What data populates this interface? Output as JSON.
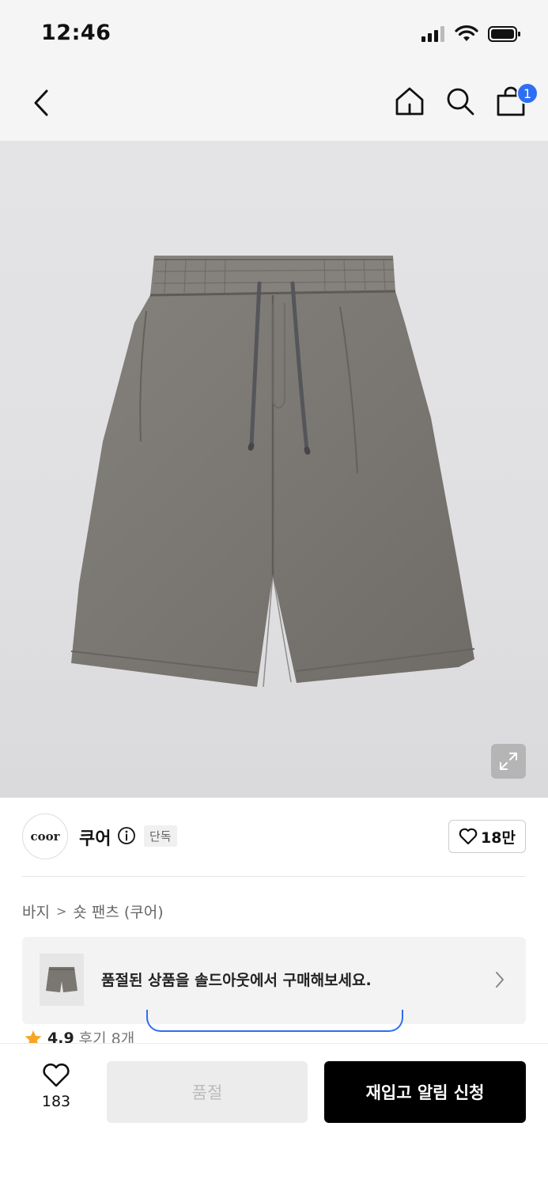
{
  "status_bar": {
    "time": "12:46"
  },
  "nav": {
    "cart_count": "1"
  },
  "product_image": {
    "alt": ""
  },
  "brand": {
    "logo_text": "coor",
    "name": "쿠어",
    "tag": "단독",
    "like_count": "18만"
  },
  "breadcrumb": {
    "items": [
      "바지",
      "숏 팬츠 (쿠어)"
    ],
    "separator": ">"
  },
  "soldout_banner": {
    "text": "품절된 상품을 솔드아웃에서 구매해보세요."
  },
  "rating": {
    "score": "4.9",
    "reviews": "후기 8개"
  },
  "bottom_bar": {
    "wish_count": "183",
    "soldout_label": "품절",
    "restock_label": "재입고 알림 신청"
  },
  "colors": {
    "accent_blue": "#2d6ef5",
    "star": "#f5a623",
    "primary_button": "#000000",
    "disabled_button": "#ececec"
  }
}
